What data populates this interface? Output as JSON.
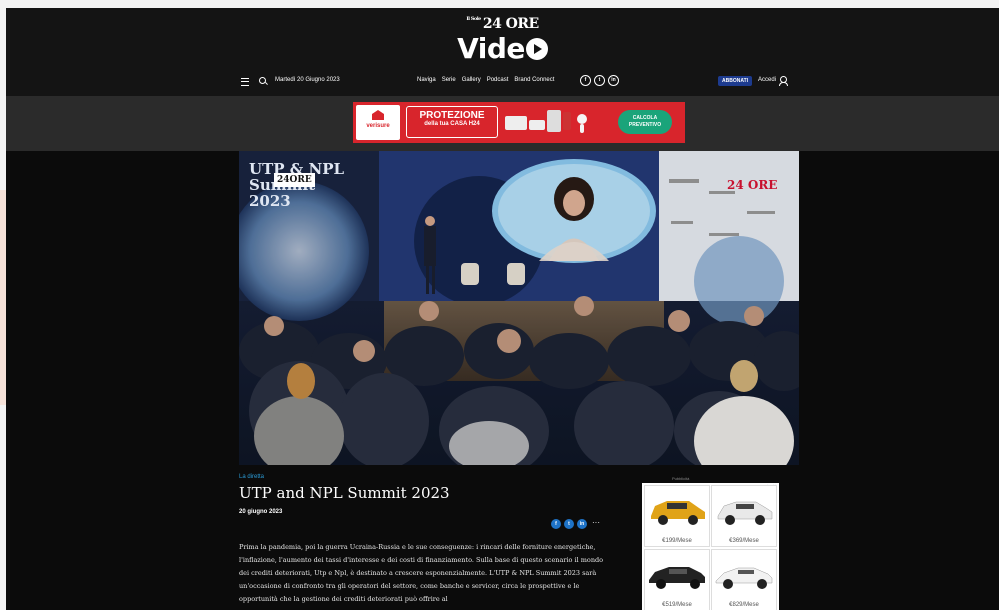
{
  "header": {
    "brand_top": "24 ORE",
    "brand_title": "Vide",
    "date": "Martedì 20 Giugno 2023",
    "nav": [
      "Naviga",
      "Serie",
      "Gallery",
      "Podcast",
      "Brand Connect"
    ],
    "social": [
      "f",
      "t",
      "in"
    ],
    "subscribe_label": "ABBONATI",
    "login_label": "Accedi"
  },
  "banner_ad": {
    "brand": "verisure",
    "headline": "PROTEZIONE",
    "subline": "della tua CASA H24",
    "cta": "CALCOLA PREVENTIVO",
    "color": "#d8252c"
  },
  "hero": {
    "stage_banner_left": "UTP & NPL Summit 2023",
    "stage_logo": "24ORE",
    "right_panel_logo": "24 ORE"
  },
  "article": {
    "kicker": "La diretta",
    "title": "UTP and NPL Summit 2023",
    "date": "20 giugno 2023",
    "share": [
      "f",
      "t",
      "in"
    ],
    "more": "···",
    "body": "Prima la pandemia, poi la guerra Ucraina-Russia e le sue conseguenze: i rincari delle forniture energetiche, l'inflazione, l'aumento dei tassi d'interesse e dei costi di finanziamento. Sulla base di questo scenario il mondo dei crediti deteriorati, Utp e Npl, è destinato a crescere esponenzialmente. L'UTP & NPL Summit 2023 sarà un'occasione di confronto tra gli operatori del settore, come banche e servicer, circa le prospettive e le opportunità che la gestione dei crediti deteriorati può offrire al"
  },
  "side_ad": {
    "label": "Pubblicità",
    "close": "▷ ✕",
    "cars": [
      {
        "price": "€199/Mese",
        "color": "#e0a318"
      },
      {
        "price": "€369/Mese",
        "color": "#eeeeee"
      },
      {
        "price": "€519/Mese",
        "color": "#222222"
      },
      {
        "price": "€829/Mese",
        "color": "#f2f2f2"
      }
    ]
  }
}
